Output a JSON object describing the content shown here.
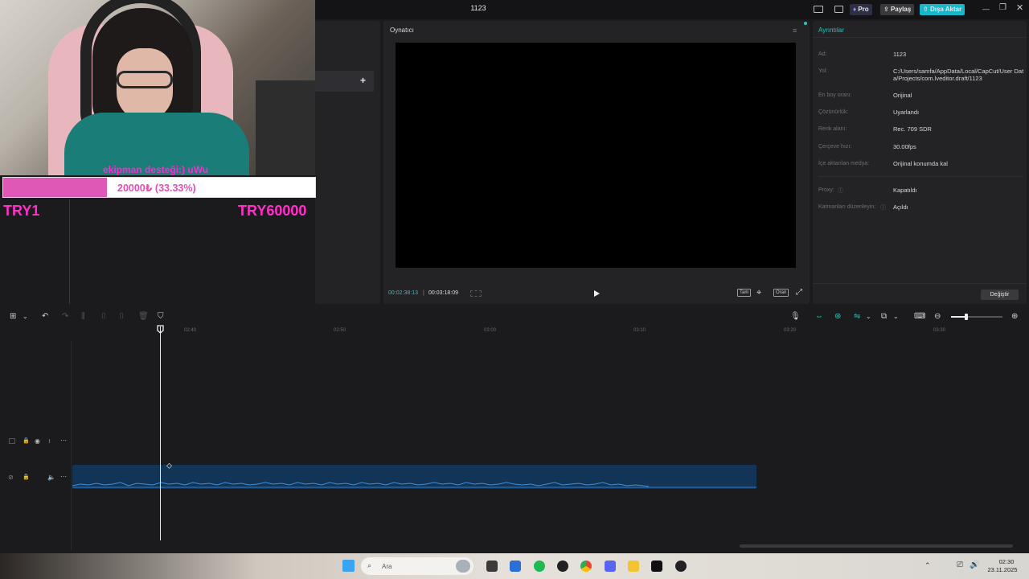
{
  "window": {
    "title": "1123"
  },
  "topbar": {
    "pro_label": "Pro",
    "share_label": "Paylaş",
    "export_label": "Dışa Aktar"
  },
  "media_panel": {
    "add_icon": "plus-icon"
  },
  "player": {
    "label": "Oynatıcı",
    "current_time": "00:02:38:13",
    "total_time": "00:03:18:09",
    "btn_full": "Tam",
    "btn_ratio": "Oran"
  },
  "details": {
    "title": "Ayrıntılar",
    "rows": [
      {
        "label": "Ad:",
        "value": "1123"
      },
      {
        "label": "Yol:",
        "value": "C:/Users/samfa/AppData/Local/CapCut/User Data/Projects/com.lveditor.draft/1123"
      },
      {
        "label": "En boy oranı:",
        "value": "Orijinal"
      },
      {
        "label": "Çözünürlük:",
        "value": "Uyarlandı"
      },
      {
        "label": "Renk alanı:",
        "value": "Rec. 709 SDR"
      },
      {
        "label": "Çerçeve hızı:",
        "value": "30.00fps"
      },
      {
        "label": "İçe aktarılan medya:",
        "value": "Orijinal konumda kal"
      },
      {
        "label": "Proxy:",
        "value": "Kapatıldı"
      },
      {
        "label": "Katmanları düzenleyin:",
        "value": "Açıldı"
      }
    ],
    "change_button": "Değiştir"
  },
  "timeline": {
    "ticks": [
      "02:40",
      "02:50",
      "03:00",
      "03:10",
      "03:20",
      "03:30"
    ]
  },
  "stream_overlay": {
    "donation_text": "ekipman desteği:) uWu",
    "goal_text": "20000₺ (33.33%)",
    "goal_progress": 0.3333,
    "goal_min": "TRY1",
    "goal_max": "TRY60000"
  },
  "taskbar": {
    "search_placeholder": "Ara",
    "time": "02:30",
    "date": "23.11.2025"
  },
  "colors": {
    "accent": "#22c8c0",
    "export": "#17b6c9",
    "goal_fill": "#df58b6"
  }
}
